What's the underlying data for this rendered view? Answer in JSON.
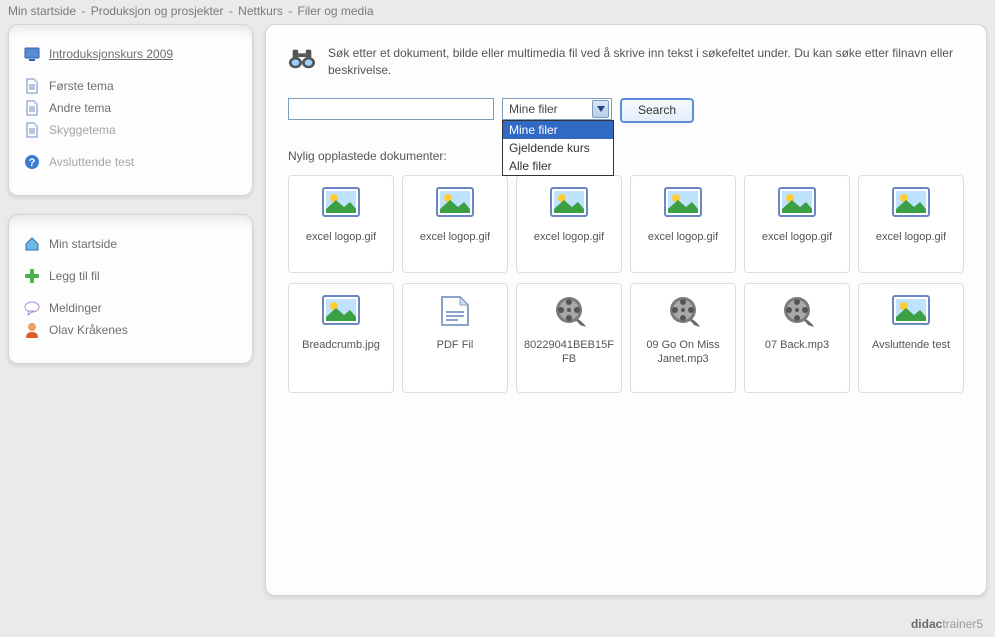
{
  "breadcrumb": [
    "Min startside",
    "Produksjon og prosjekter",
    "Nettkurs",
    "Filer og media"
  ],
  "sidebar": {
    "group1": [
      {
        "icon": "monitor",
        "label": "Introduksjonskurs 2009",
        "current": true
      },
      {
        "spacer": true
      },
      {
        "icon": "doc",
        "label": "Første tema"
      },
      {
        "icon": "doc",
        "label": "Andre tema"
      },
      {
        "icon": "doc",
        "label": "Skyggetema",
        "dim": true
      },
      {
        "spacer": true
      },
      {
        "icon": "help",
        "label": "Avsluttende test",
        "dim": true
      }
    ],
    "group2": [
      {
        "icon": "home",
        "label": "Min startside"
      },
      {
        "spacer": true
      },
      {
        "icon": "plus",
        "label": "Legg til fil"
      },
      {
        "spacer": true
      },
      {
        "icon": "chat",
        "label": "Meldinger"
      },
      {
        "icon": "user",
        "label": "Olav Kråkenes"
      }
    ]
  },
  "main": {
    "intro": "Søk etter et dokument, bilde eller multimedia fil ved å skrive inn tekst i søkefeltet under. Du kan søke etter filnavn eller beskrivelse.",
    "search_value": "",
    "select_value": "Mine filer",
    "select_options": [
      "Mine filer",
      "Gjeldende kurs",
      "Alle filer"
    ],
    "search_button": "Search",
    "recent_label": "Nylig opplastede dokumenter:",
    "files_row1": [
      {
        "thumb": "image",
        "label": "excel logop.gif"
      },
      {
        "thumb": "image",
        "label": "excel logop.gif"
      },
      {
        "thumb": "image",
        "label": "excel logop.gif"
      },
      {
        "thumb": "image",
        "label": "excel logop.gif"
      },
      {
        "thumb": "image",
        "label": "excel logop.gif"
      },
      {
        "thumb": "image",
        "label": "excel logop.gif"
      }
    ],
    "files_row2": [
      {
        "thumb": "image",
        "label": "Breadcrumb.jpg"
      },
      {
        "thumb": "pdf",
        "label": "PDF Fil"
      },
      {
        "thumb": "video",
        "label": "80229041BEB15FFB"
      },
      {
        "thumb": "video",
        "label": "09 Go On Miss Janet.mp3"
      },
      {
        "thumb": "video",
        "label": "07 Back.mp3"
      },
      {
        "thumb": "image",
        "label": "Avsluttende test"
      }
    ]
  },
  "footer": {
    "brand1": "didac",
    "brand2": "trainer5"
  }
}
